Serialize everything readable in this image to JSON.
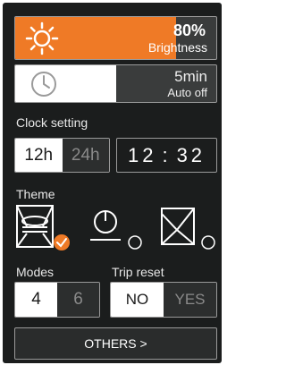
{
  "brightness": {
    "value_text": "80%",
    "label": "Brightness",
    "level": 0.8
  },
  "auto_off": {
    "value_text": "5min",
    "label": "Auto off",
    "level": 0.5
  },
  "clock_setting": {
    "label": "Clock setting",
    "options": [
      "12h",
      "24h"
    ],
    "selected": "12h",
    "hour": "12",
    "separator": ":",
    "minute": "32"
  },
  "theme": {
    "label": "Theme",
    "options": [
      "theme-1",
      "theme-2",
      "theme-3"
    ],
    "selected_index": 0
  },
  "modes": {
    "label": "Modes",
    "options": [
      "4",
      "6"
    ],
    "selected": "4"
  },
  "trip_reset": {
    "label": "Trip reset",
    "options": [
      "NO",
      "YES"
    ],
    "selected": "NO"
  },
  "others_button": {
    "label": "OTHERS >"
  },
  "colors": {
    "accent": "#ef7a26",
    "background": "#1b1d1d",
    "border": "#9a9a9a"
  }
}
